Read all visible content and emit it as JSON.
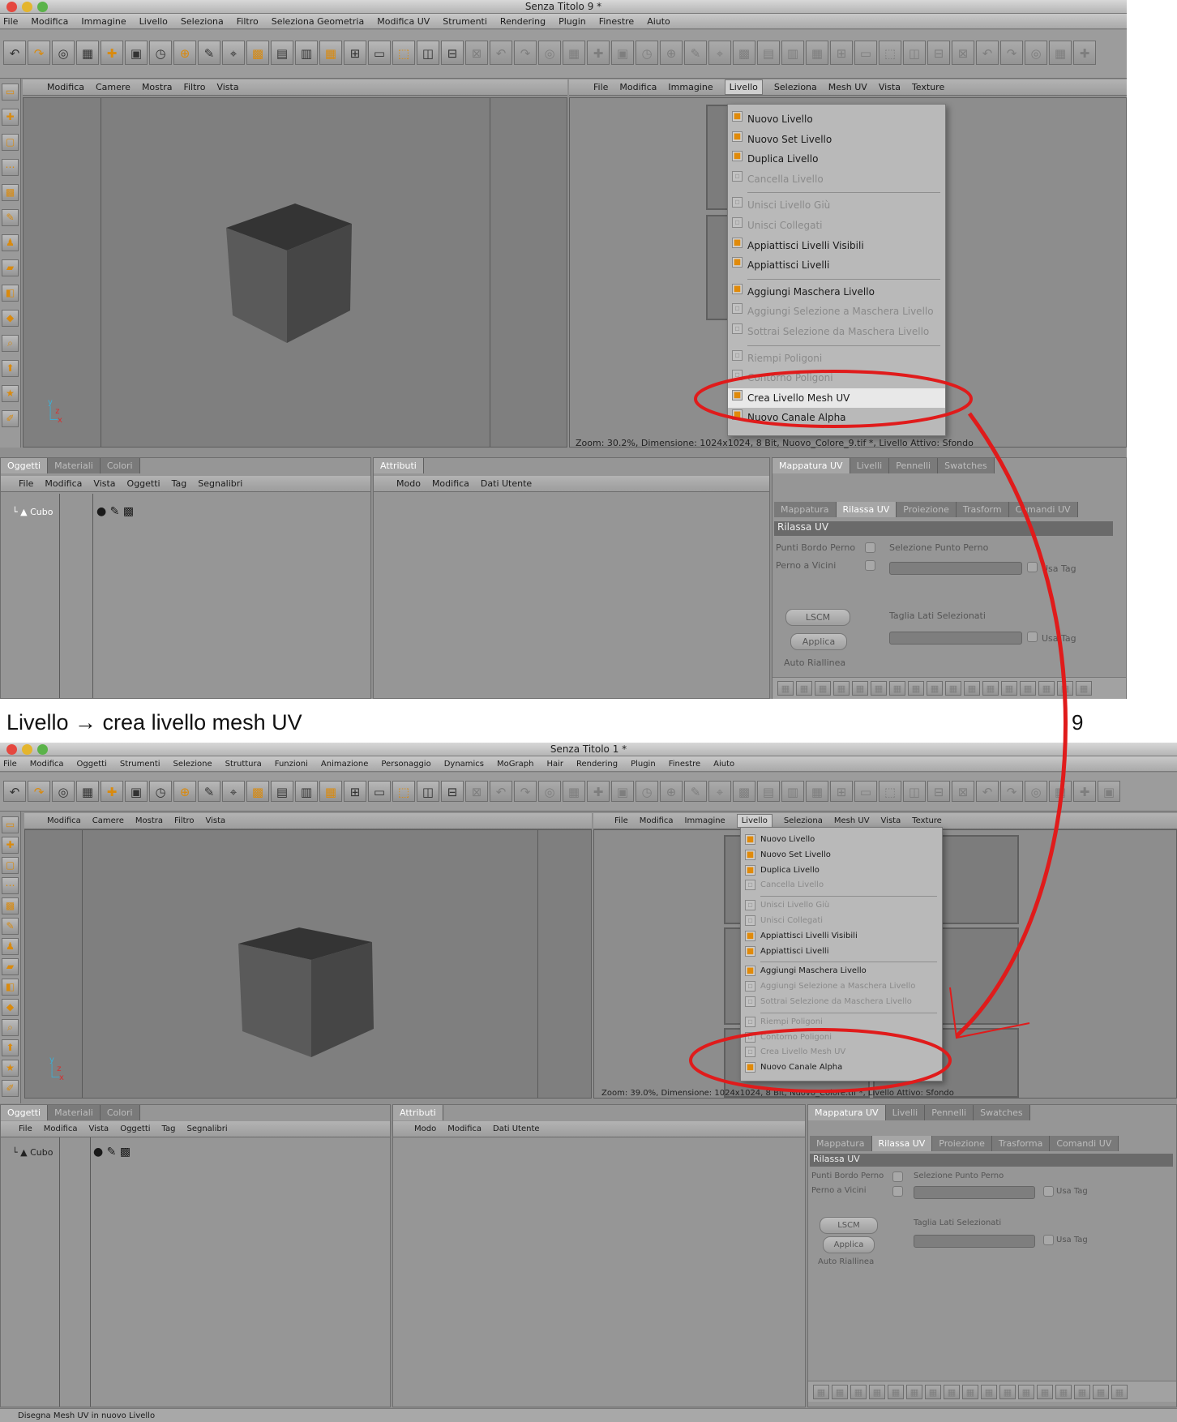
{
  "win1": {
    "title": "Senza Titolo 9 *",
    "menu": [
      "File",
      "Modifica",
      "Immagine",
      "Livello",
      "Seleziona",
      "Filtro",
      "Seleziona Geometria",
      "Modifica UV",
      "Strumenti",
      "Rendering",
      "Plugin",
      "Finestre",
      "Aiuto"
    ],
    "vp_menu": [
      "Modifica",
      "Camere",
      "Mostra",
      "Filtro",
      "Vista"
    ],
    "bp_menu": [
      "File",
      "Modifica",
      "Immagine",
      "Livello",
      "Seleziona",
      "Mesh UV",
      "Vista",
      "Texture"
    ],
    "zoom": "Zoom: 30.2%, Dimensione: 1024x1024, 8 Bit, Nuovo_Colore_9.tif *, Livello Attivo: Sfondo"
  },
  "win2": {
    "title": "Senza Titolo 1 *",
    "menu": [
      "File",
      "Modifica",
      "Oggetti",
      "Strumenti",
      "Selezione",
      "Struttura",
      "Funzioni",
      "Animazione",
      "Personaggio",
      "Dynamics",
      "MoGraph",
      "Hair",
      "Rendering",
      "Plugin",
      "Finestre",
      "Aiuto"
    ],
    "vp_menu": [
      "Modifica",
      "Camere",
      "Mostra",
      "Filtro",
      "Vista"
    ],
    "bp_menu": [
      "File",
      "Modifica",
      "Immagine",
      "Livello",
      "Seleziona",
      "Mesh UV",
      "Vista",
      "Texture"
    ],
    "zoom": "Zoom: 39.0%, Dimensione: 1024x1024, 8 Bit, Nuovo_Colore.tif *, Livello Attivo: Sfondo",
    "status": "Disegna Mesh UV in nuovo Livello"
  },
  "livello_menu": [
    {
      "label": "Nuovo Livello",
      "enabled": true
    },
    {
      "label": "Nuovo Set Livello",
      "enabled": true
    },
    {
      "label": "Duplica Livello",
      "enabled": true
    },
    {
      "label": "Cancella Livello",
      "enabled": false
    },
    {
      "label": "Unisci Livello Giù",
      "enabled": false
    },
    {
      "label": "Unisci Collegati",
      "enabled": false
    },
    {
      "label": "Appiattisci Livelli Visibili",
      "enabled": true
    },
    {
      "label": "Appiattisci Livelli",
      "enabled": true
    },
    {
      "label": "Aggiungi Maschera Livello",
      "enabled": true
    },
    {
      "label": "Aggiungi Selezione a Maschera Livello",
      "enabled": false
    },
    {
      "label": "Sottrai Selezione da Maschera Livello",
      "enabled": false
    },
    {
      "label": "Riempi Poligoni",
      "enabled": false
    },
    {
      "label": "Contorno Poligoni",
      "enabled": false
    },
    {
      "label": "Crea Livello Mesh UV",
      "enabled": true
    },
    {
      "label": "Nuovo Canale Alpha",
      "enabled": true
    }
  ],
  "obj_tabs": [
    "Oggetti",
    "Materiali",
    "Colori"
  ],
  "obj_menu": [
    "File",
    "Modifica",
    "Vista",
    "Oggetti",
    "Tag",
    "Segnalibri"
  ],
  "obj_item": "Cubo",
  "attr_tab": "Attributi",
  "attr_menu": [
    "Modo",
    "Modifica",
    "Dati Utente"
  ],
  "uv_tabs": [
    "Mappatura UV",
    "Livelli",
    "Pennelli",
    "Swatches"
  ],
  "uv_subtabs": [
    "Mappatura",
    "Rilassa UV",
    "Proiezione",
    "Trasforma",
    "Comandi UV"
  ],
  "uv_subtabs1": [
    "Mappatura",
    "Rilassa UV",
    "Proiezione",
    "Trasform",
    "Comandi UV"
  ],
  "uv": {
    "section": "Rilassa UV",
    "punti": "Punti Bordo Perno",
    "perno": "Perno a Vicini",
    "sel_punto": "Selezione Punto Perno",
    "usa_tag": "Usa Tag",
    "taglia": "Taglia Lati Selezionati",
    "lscm": "LSCM",
    "applica": "Applica",
    "auto": "Auto Riallinea"
  },
  "caption": "Livello → crea livello mesh UV",
  "step": "9",
  "accent": "#e01b1b"
}
